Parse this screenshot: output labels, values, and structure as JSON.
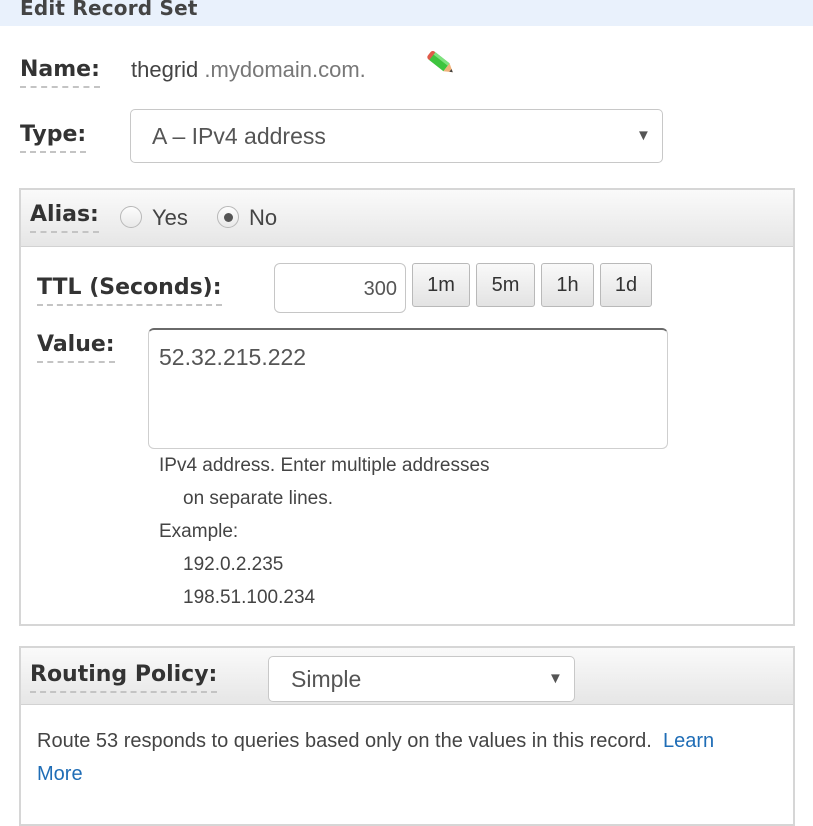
{
  "header": {
    "title": "Edit Record Set"
  },
  "name": {
    "label": "Name:",
    "value": "thegrid",
    "suffix": ".mydomain.com.",
    "edit_icon": "pencil-icon"
  },
  "type": {
    "label": "Type:",
    "selected": "A – IPv4 address",
    "arrow": "▼"
  },
  "alias": {
    "label": "Alias:",
    "options": [
      {
        "label": "Yes",
        "checked": false
      },
      {
        "label": "No",
        "checked": true
      }
    ]
  },
  "ttl": {
    "label": "TTL (Seconds):",
    "value": "300",
    "presets": [
      "1m",
      "5m",
      "1h",
      "1d"
    ]
  },
  "value": {
    "label": "Value:",
    "content": "52.32.215.222",
    "help": {
      "line1": "IPv4 address. Enter multiple addresses",
      "line2": "on separate lines.",
      "example_label": "Example:",
      "examples": [
        "192.0.2.235",
        "198.51.100.234"
      ]
    }
  },
  "routing": {
    "label": "Routing Policy:",
    "selected": "Simple",
    "arrow": "▼",
    "description": "Route 53 responds to queries based only on the values in this record.",
    "link_line1": "Learn",
    "link_line2": "More"
  },
  "colors": {
    "header_bg": "#e9f1fc",
    "link": "#1f6db6",
    "panel_border": "#d6d6d6"
  }
}
